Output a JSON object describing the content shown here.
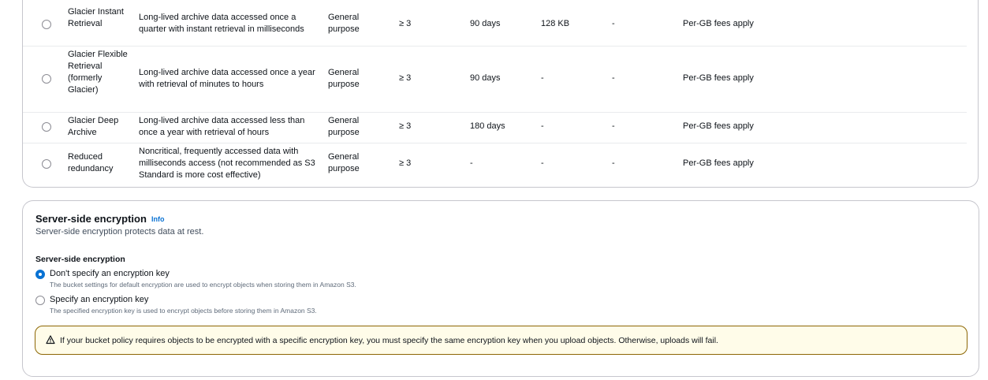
{
  "storage_classes": [
    {
      "name": "Glacier Instant Retrieval",
      "description": "Long-lived archive data accessed once a quarter with instant retrieval in milliseconds",
      "designed_for": "General purpose",
      "az": "≥ 3",
      "min_duration": "90 days",
      "min_object": "128 KB",
      "monitoring": "-",
      "fees": "Per-GB fees apply"
    },
    {
      "name": "Glacier Flexible Retrieval (formerly Glacier)",
      "description": "Long-lived archive data accessed once a year with retrieval of minutes to hours",
      "designed_for": "General purpose",
      "az": "≥ 3",
      "min_duration": "90 days",
      "min_object": "-",
      "monitoring": "-",
      "fees": "Per-GB fees apply"
    },
    {
      "name": "Glacier Deep Archive",
      "description": "Long-lived archive data accessed less than once a year with retrieval of hours",
      "designed_for": "General purpose",
      "az": "≥ 3",
      "min_duration": "180 days",
      "min_object": "-",
      "monitoring": "-",
      "fees": "Per-GB fees apply"
    },
    {
      "name": "Reduced redundancy",
      "description": "Noncritical, frequently accessed data with milliseconds access (not recommended as S3 Standard is more cost effective)",
      "designed_for": "General purpose",
      "az": "≥ 3",
      "min_duration": "-",
      "min_object": "-",
      "monitoring": "-",
      "fees": "Per-GB fees apply"
    }
  ],
  "encryption": {
    "title": "Server-side encryption",
    "info": "Info",
    "description": "Server-side encryption protects data at rest.",
    "field_label": "Server-side encryption",
    "options": [
      {
        "label": "Don't specify an encryption key",
        "hint": "The bucket settings for default encryption are used to encrypt objects when storing them in Amazon S3.",
        "selected": true
      },
      {
        "label": "Specify an encryption key",
        "hint": "The specified encryption key is used to encrypt objects before storing them in Amazon S3.",
        "selected": false
      }
    ],
    "alert": "If your bucket policy requires objects to be encrypted with a specific encryption key, you must specify the same encryption key when you upload objects. Otherwise, uploads will fail."
  },
  "colors": {
    "accent": "#0972d3",
    "warning_border": "#8d6605",
    "warning_bg": "#fffce9"
  }
}
